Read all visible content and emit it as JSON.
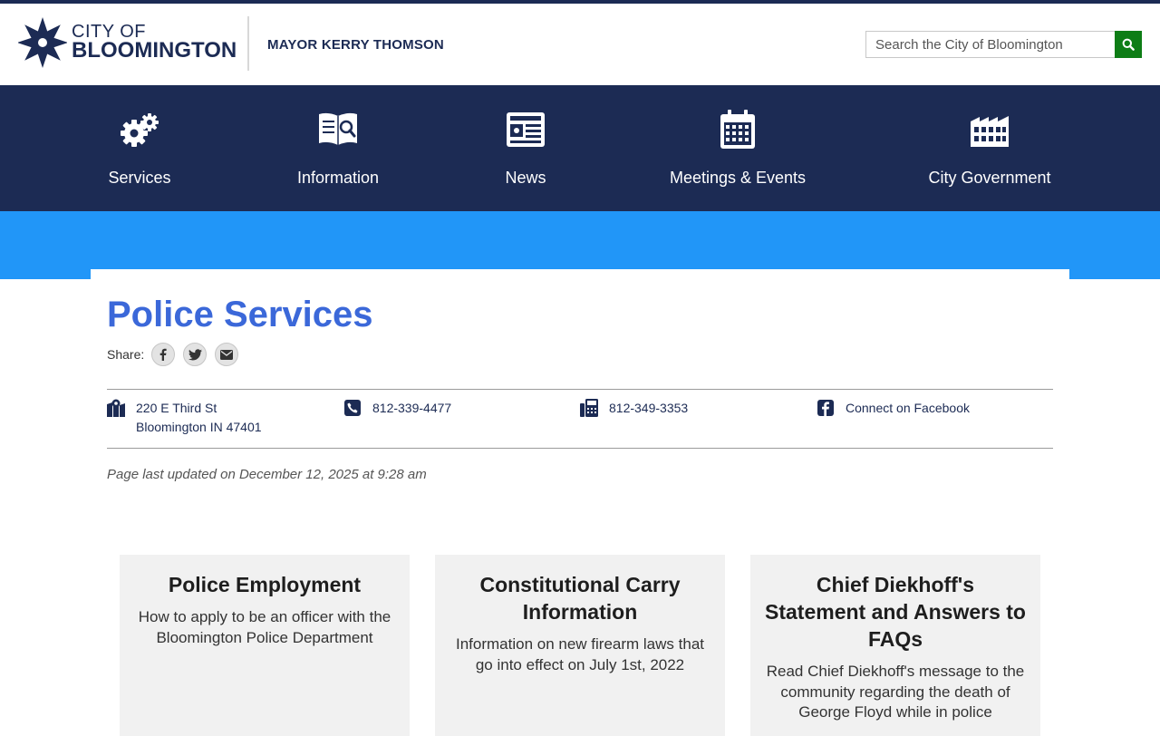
{
  "header": {
    "logo": {
      "line1": "CITY OF",
      "line2": "BLOOMINGTON"
    },
    "mayor_label": "MAYOR KERRY THOMSON",
    "search": {
      "placeholder": "Search the City of Bloomington",
      "button_icon": "search-icon"
    }
  },
  "nav": {
    "items": [
      {
        "label": "Services",
        "icon": "gears-icon"
      },
      {
        "label": "Information",
        "icon": "book-search-icon"
      },
      {
        "label": "News",
        "icon": "newspaper-icon"
      },
      {
        "label": "Meetings & Events",
        "icon": "calendar-icon"
      },
      {
        "label": "City Government",
        "icon": "building-icon"
      }
    ]
  },
  "page": {
    "title": "Police Services",
    "share_label": "Share:",
    "share_icons": [
      "facebook-icon",
      "twitter-icon",
      "email-icon"
    ],
    "contact": {
      "address_line1": "220 E Third St",
      "address_line2": "Bloomington IN 47401",
      "phone": "812-339-4477",
      "fax": "812-349-3353",
      "facebook": "Connect on Facebook"
    },
    "last_updated": "Page last updated on December 12, 2025 at 9:28 am"
  },
  "cards": [
    {
      "title": "Police Employment",
      "description": "How to apply to be an officer with the Bloomington Police Department"
    },
    {
      "title": "Constitutional Carry Information",
      "description": "Information on new firearm laws that go into effect on July 1st, 2022"
    },
    {
      "title": "Chief Diekhoff's Statement and Answers to FAQs",
      "description": "Read Chief Diekhoff's message to the community regarding the death of George Floyd while in police"
    }
  ],
  "colors": {
    "navy": "#1c2b54",
    "hero_blue": "#2196f8",
    "title_blue": "#3b68d9",
    "search_green": "#0e7d16",
    "card_bg": "#f1f1f1"
  }
}
